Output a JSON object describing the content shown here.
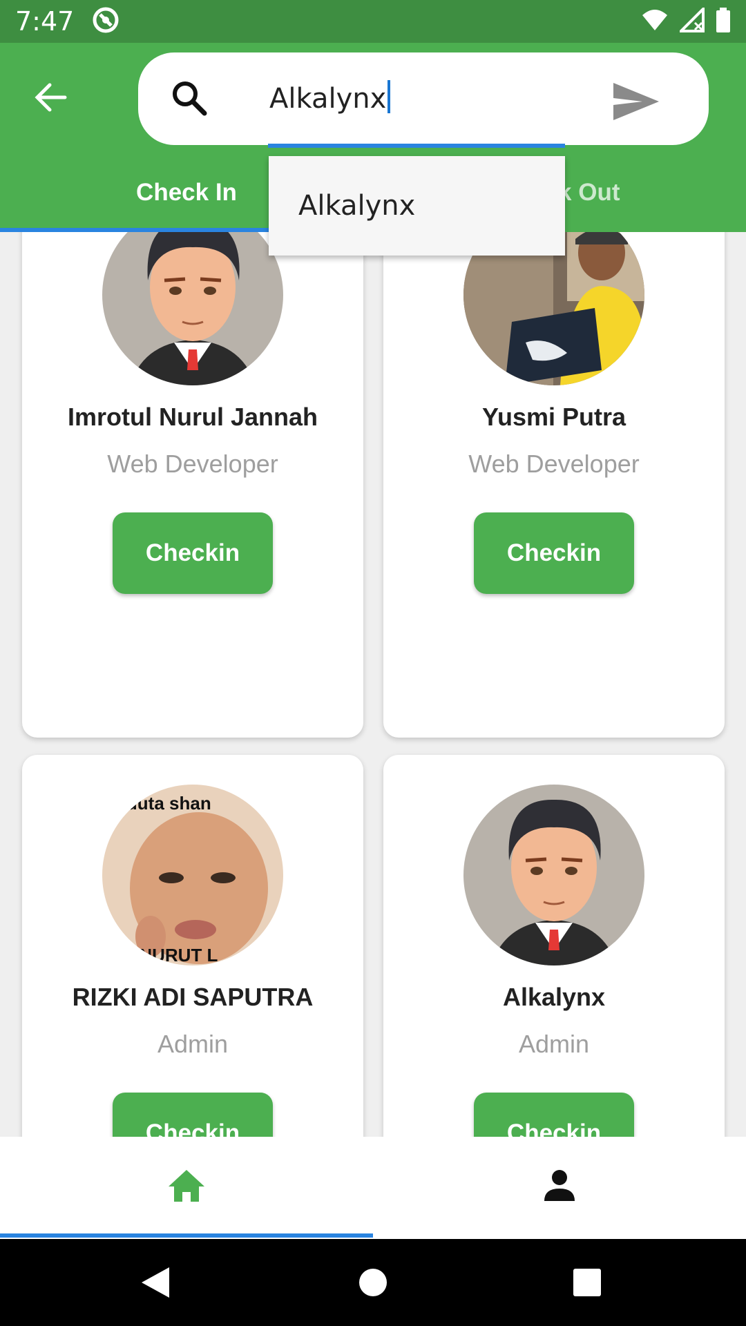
{
  "status_bar": {
    "time": "7:47"
  },
  "search": {
    "value": "Alkalynx",
    "suggestions": [
      "Alkalynx"
    ]
  },
  "tabs": [
    {
      "label": "Check In",
      "active": true
    },
    {
      "label": "Check Out",
      "active": false
    }
  ],
  "employees": [
    {
      "name": "Imrotul Nurul Jannah",
      "role": "Web Developer",
      "button": "Checkin",
      "avatar": "cartoon-man-avatar"
    },
    {
      "name": "Yusmi Putra",
      "role": "Web Developer",
      "button": "Checkin",
      "avatar": "photo-man-laptop"
    },
    {
      "name": "RIZKI ADI SAPUTRA",
      "role": "Admin",
      "button": "Checkin",
      "avatar": "meme-photo",
      "avatar_text_top": "ai duta shan",
      "avatar_text_bottom": "ENURUT L"
    },
    {
      "name": "Alkalynx",
      "role": "Admin",
      "button": "Checkin",
      "avatar": "cartoon-man-avatar"
    }
  ],
  "bottom_nav": [
    {
      "icon": "home-icon",
      "active": true
    },
    {
      "icon": "person-icon",
      "active": false
    }
  ],
  "colors": {
    "primary": "#4caf50",
    "status_bar": "#3e8e41",
    "accent": "#2a84e0"
  }
}
